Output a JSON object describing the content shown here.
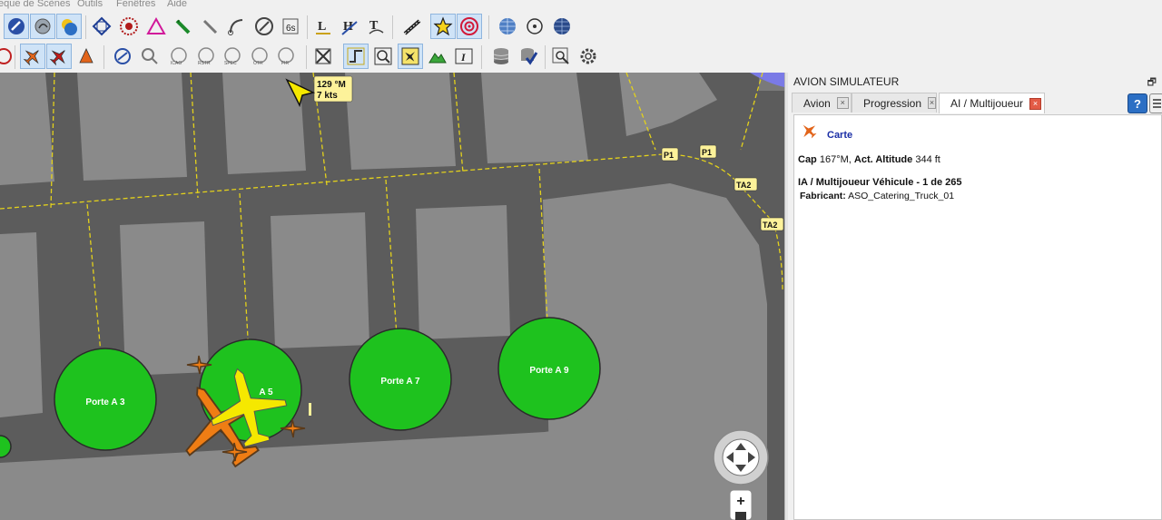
{
  "menu": {
    "item1": "eque de Scènes",
    "item2": "Outils",
    "item3": "Fenêtres",
    "item4": "Aide"
  },
  "map": {
    "aircraft_tooltip": {
      "heading": "129 °M",
      "speed": "7 kts"
    },
    "taxiway_labels": [
      "P1",
      "P1",
      "TA2",
      "TA2"
    ],
    "gates": [
      "Porte A 3",
      "A 5",
      "Porte A 7",
      "Porte A 9"
    ],
    "zoom_in_label": "+",
    "colors": {
      "ground": "#5c5c5c",
      "apron": "#8a8a8a",
      "gate": "#1ec21e",
      "taxiline": "#e3d11c",
      "label_bg": "#fdf29a"
    }
  },
  "panel": {
    "title": "AVION SIMULATEUR",
    "restore_icon": "restore-icon",
    "tabs": [
      {
        "label": "Avion"
      },
      {
        "label": "Progression"
      },
      {
        "label": "AI / Multijoueur"
      }
    ],
    "help_icon": "help-icon",
    "map_link": "Carte",
    "heading_label": "Cap",
    "heading_value": "167°M,",
    "altitude_label": "Act. Altitude",
    "altitude_value": "344 ft",
    "vehicle_header": "IA / Multijoueur Véhicule - 1 de 265",
    "manufacturer_label": "Fabricant:",
    "manufacturer_value": "ASO_Catering_Truck_01"
  },
  "toolbar": {
    "row1_icons": [
      "map-icon",
      "weather-icon",
      "day-night-icon",
      "airway-icon",
      "vor-icon",
      "ndb-icon",
      "pen-icon",
      "ruler-icon",
      "line-icon",
      "compass-icon",
      "timer-icon",
      "label-l-icon",
      "label-h-icon",
      "label-t-icon",
      "runway-icon",
      "star-icon",
      "target-icon",
      "globe-icon",
      "circle-icon",
      "globe-dark-icon"
    ],
    "timer_text": "6s",
    "row2_icons": [
      "route-icon",
      "aircraft-ai-icon",
      "aircraft-ai-2-icon",
      "aircraft-ai-3-icon",
      "airspace-icon",
      "airspace-2-icon",
      "icao-icon",
      "restr-icon",
      "spec-icon",
      "otr-icon",
      "fir-icon",
      "center-icon",
      "track-icon",
      "zoom-icon",
      "aircraft-view-icon",
      "elevation-icon",
      "info-icon",
      "database-icon",
      "database-check-icon",
      "search-icon",
      "settings-icon"
    ],
    "icao_text": "ICAO",
    "restr_text": "RSTR",
    "spec_text": "SPEC",
    "otr_text": "OTR",
    "fir_text": "FIR"
  }
}
